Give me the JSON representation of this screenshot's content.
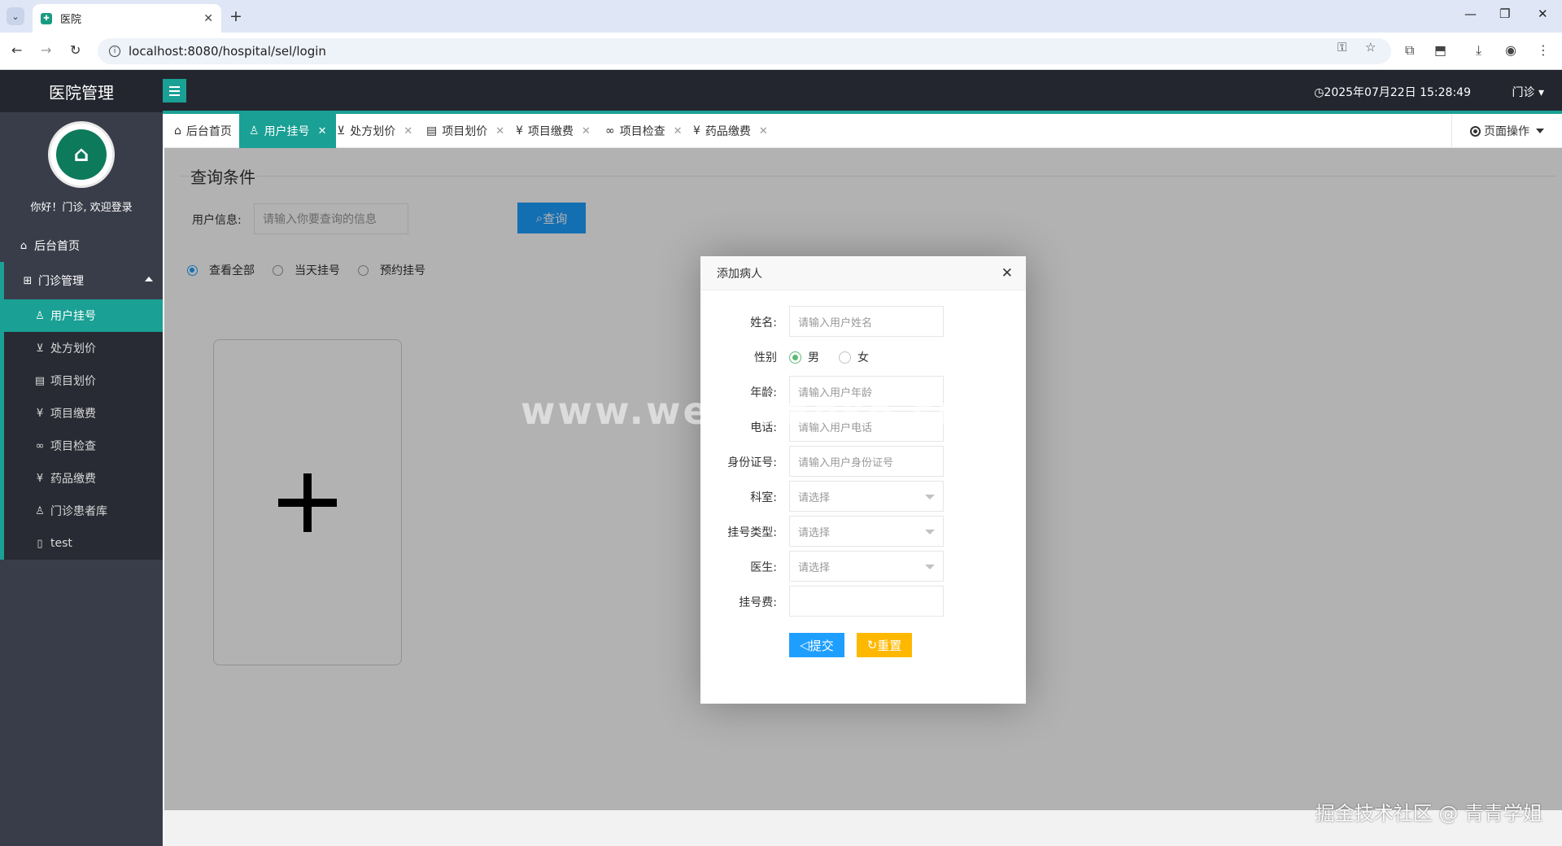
{
  "browser": {
    "tab_title": "医院",
    "url": "localhost:8080/hospital/sel/login"
  },
  "header": {
    "logo": "医院管理",
    "datetime": "2025年07月22日 15:28:49",
    "user_menu": "门诊"
  },
  "sidebar": {
    "welcome": "你好！门诊, 欢迎登录",
    "home": "后台首页",
    "group": "门诊管理",
    "items": [
      {
        "label": "用户挂号",
        "icon": "user-icon",
        "glyph": "♙",
        "active": true
      },
      {
        "label": "处方划价",
        "icon": "cart-icon",
        "glyph": "⊻",
        "active": false
      },
      {
        "label": "项目划价",
        "icon": "file-icon",
        "glyph": "▤",
        "active": false
      },
      {
        "label": "项目缴费",
        "icon": "yen-icon",
        "glyph": "¥",
        "active": false
      },
      {
        "label": "项目检查",
        "icon": "link-icon",
        "glyph": "∞",
        "active": false
      },
      {
        "label": "药品缴费",
        "icon": "yen-icon",
        "glyph": "¥",
        "active": false
      },
      {
        "label": "门诊患者库",
        "icon": "user-icon",
        "glyph": "♙",
        "active": false
      },
      {
        "label": "test",
        "icon": "tablet-icon",
        "glyph": "▯",
        "active": false
      }
    ]
  },
  "tabs": [
    {
      "label": "后台首页",
      "closable": false,
      "active": false
    },
    {
      "label": "用户挂号",
      "closable": true,
      "active": true
    },
    {
      "label": "处方划价",
      "closable": true,
      "active": false
    },
    {
      "label": "项目划价",
      "closable": true,
      "active": false
    },
    {
      "label": "项目缴费",
      "closable": true,
      "active": false
    },
    {
      "label": "项目检查",
      "closable": true,
      "active": false
    },
    {
      "label": "药品缴费",
      "closable": true,
      "active": false
    }
  ],
  "page_ops": "页面操作",
  "main": {
    "section_title": "查询条件",
    "query_label": "用户信息:",
    "query_placeholder": "请输入你要查询的信息",
    "query_button": "查询",
    "radios": [
      {
        "label": "查看全部",
        "checked": true
      },
      {
        "label": "当天挂号",
        "checked": false
      },
      {
        "label": "预约挂号",
        "checked": false
      }
    ]
  },
  "modal": {
    "title": "添加病人",
    "fields": {
      "name": {
        "label": "姓名:",
        "placeholder": "请输入用户姓名"
      },
      "gender": {
        "label": "性别",
        "options": [
          "男",
          "女"
        ],
        "selected": "男"
      },
      "age": {
        "label": "年龄:",
        "placeholder": "请输入用户年龄"
      },
      "phone": {
        "label": "电话:",
        "placeholder": "请输入用户电话"
      },
      "idcard": {
        "label": "身份证号:",
        "placeholder": "请输入用户身份证号"
      },
      "department": {
        "label": "科室:",
        "value": "请选择"
      },
      "reg_type": {
        "label": "挂号类型:",
        "value": "请选择"
      },
      "doctor": {
        "label": "医生:",
        "value": "请选择"
      },
      "fee": {
        "label": "挂号费:",
        "value": ""
      }
    },
    "submit": "提交",
    "reset": "重置"
  },
  "watermarks": {
    "center": "www.weiguanke.cn",
    "corner": "掘金技术社区 @ 青青学姐"
  },
  "colors": {
    "accent": "#1aa094",
    "primary_button": "#1e9fff",
    "reset_button": "#ffb800",
    "sidebar_bg": "#393d49",
    "header_bg": "#23262e"
  }
}
